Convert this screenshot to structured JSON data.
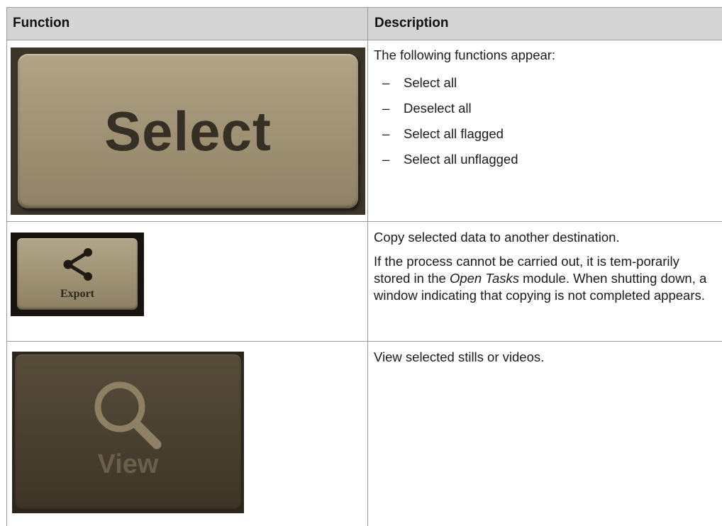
{
  "table": {
    "headers": {
      "function": "Function",
      "description": "Description"
    },
    "rows": [
      {
        "button": {
          "label": "Select"
        },
        "intro": "The following functions appear:",
        "bullets": [
          {
            "dash": "–",
            "text": "Select all"
          },
          {
            "dash": "–",
            "text": "Deselect all"
          },
          {
            "dash": "–",
            "text": "Select all flagged"
          },
          {
            "dash": "–",
            "text": "Select all unflagged"
          }
        ]
      },
      {
        "button": {
          "label": "Export",
          "icon": "share-icon"
        },
        "para1": "Copy selected data to another destination.",
        "para2_pre": "If the process cannot be carried out, it is tem-porarily stored in the ",
        "para2_em": "Open Tasks",
        "para2_post": " module. When shutting down, a window indicating that copying is not completed appears."
      },
      {
        "button": {
          "label": "View",
          "icon": "magnifier-icon"
        },
        "para1": "View selected stills or videos."
      }
    ]
  },
  "colors": {
    "header_bg": "#d4d4d4",
    "grid_line": "#9a9a9a",
    "button_light": "#a39678",
    "button_dark": "#4b4131"
  }
}
